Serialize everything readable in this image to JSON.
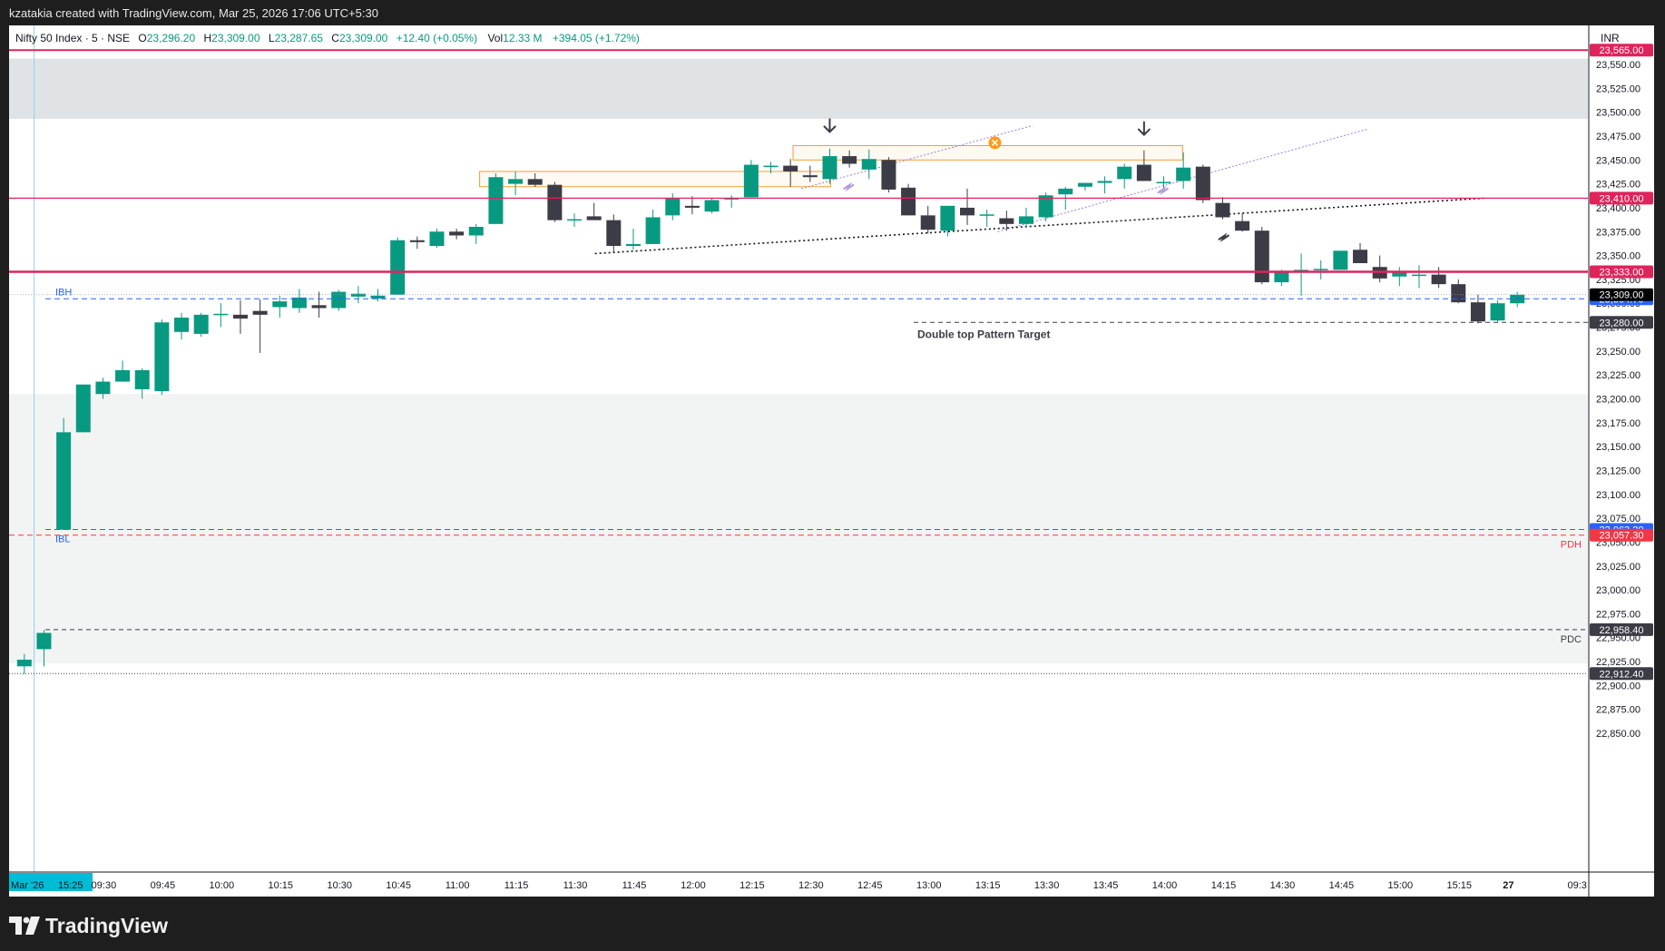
{
  "header": {
    "text": "kzatakia created with TradingView.com, Mar 25, 2026 17:06 UTC+5:30"
  },
  "legend": {
    "symbol": "Nifty 50 Index · 5 · NSE",
    "o_label": "O",
    "o_value": "23,296.20",
    "h_label": "H",
    "h_value": "23,309.00",
    "l_label": "L",
    "l_value": "23,287.65",
    "c_label": "C",
    "c_value": "23,309.00",
    "change": "+12.40 (+0.05%)",
    "vol_label": "Vol",
    "vol_value": "12.33 M",
    "vol_change": "+394.05 (+1.72%)"
  },
  "currency": "INR",
  "footer": {
    "brand": "TradingView"
  },
  "colors": {
    "up": "#089981",
    "down": "#3c3c46",
    "level_red": "#e0235a",
    "level_blue": "#2962ff",
    "pdh_red": "#f23645",
    "zone_gray": "#e0e3e6",
    "zone_light": "#f2f4f4",
    "box_orange": "#f0a030"
  },
  "chart_data": {
    "type": "candlestick",
    "title": "Nifty 50 Index · 5 · NSE",
    "ylim": [
      22830,
      23578
    ],
    "price_ticks": [
      "22,850.00",
      "22,875.00",
      "22,900.00",
      "22,925.00",
      "22,950.00",
      "22,975.00",
      "23,000.00",
      "23,025.00",
      "23,050.00",
      "23,075.00",
      "23,100.00",
      "23,125.00",
      "23,150.00",
      "23,175.00",
      "23,200.00",
      "23,225.00",
      "23,250.00",
      "23,275.00",
      "23,300.00",
      "23,325.00",
      "23,350.00",
      "23,375.00",
      "23,400.00",
      "23,425.00",
      "23,450.00",
      "23,475.00",
      "23,500.00",
      "23,525.00",
      "23,550.00"
    ],
    "time_ticks": [
      {
        "label": "Mar '26",
        "i": 0.5,
        "hl": true
      },
      {
        "label": "15:25",
        "i": 2.8,
        "hl": true
      },
      {
        "label": "09:30",
        "i": 4.5
      },
      {
        "label": "09:45",
        "i": 7.5
      },
      {
        "label": "10:00",
        "i": 10.5
      },
      {
        "label": "10:15",
        "i": 13.5
      },
      {
        "label": "10:30",
        "i": 16.5
      },
      {
        "label": "10:45",
        "i": 19.5
      },
      {
        "label": "11:00",
        "i": 22.5
      },
      {
        "label": "11:15",
        "i": 25.5
      },
      {
        "label": "11:30",
        "i": 28.5
      },
      {
        "label": "11:45",
        "i": 31.5
      },
      {
        "label": "12:00",
        "i": 34.5
      },
      {
        "label": "12:15",
        "i": 37.5
      },
      {
        "label": "12:30",
        "i": 40.5
      },
      {
        "label": "12:45",
        "i": 43.5
      },
      {
        "label": "13:00",
        "i": 46.5
      },
      {
        "label": "13:15",
        "i": 49.5
      },
      {
        "label": "13:30",
        "i": 52.5
      },
      {
        "label": "13:45",
        "i": 55.5
      },
      {
        "label": "14:00",
        "i": 58.5
      },
      {
        "label": "14:15",
        "i": 61.5
      },
      {
        "label": "14:30",
        "i": 64.5
      },
      {
        "label": "14:45",
        "i": 67.5
      },
      {
        "label": "15:00",
        "i": 70.5
      },
      {
        "label": "15:15",
        "i": 73.5
      },
      {
        "label": "27",
        "i": 76,
        "bold": true
      },
      {
        "label": "09:3",
        "i": 79.5
      }
    ],
    "candles": [
      [
        22920,
        22933,
        22912,
        22927
      ],
      [
        22938,
        22958,
        22920,
        22955
      ],
      [
        23063,
        23180,
        23063,
        23165
      ],
      [
        23165,
        23180,
        23165,
        23215
      ],
      [
        23205,
        23222,
        23200,
        23218
      ],
      [
        23218,
        23240,
        23218,
        23230
      ],
      [
        23210,
        23232,
        23200,
        23230
      ],
      [
        23208,
        23283,
        23204,
        23280
      ],
      [
        23270,
        23290,
        23262,
        23285
      ],
      [
        23268,
        23290,
        23265,
        23288
      ],
      [
        23288,
        23300,
        23275,
        23289
      ],
      [
        23288,
        23303,
        23268,
        23284
      ],
      [
        23292,
        23304,
        23248,
        23288
      ],
      [
        23296,
        23308,
        23285,
        23302
      ],
      [
        23295,
        23315,
        23290,
        23306
      ],
      [
        23298,
        23312,
        23285,
        23295
      ],
      [
        23295,
        23314,
        23292,
        23312
      ],
      [
        23307,
        23318,
        23300,
        23310
      ],
      [
        23305,
        23315,
        23302,
        23308
      ],
      [
        23309,
        23369,
        23309,
        23366
      ],
      [
        23366,
        23370,
        23357,
        23364
      ],
      [
        23360,
        23378,
        23358,
        23375
      ],
      [
        23375,
        23378,
        23367,
        23371
      ],
      [
        23371,
        23383,
        23362,
        23380
      ],
      [
        23383,
        23436,
        23383,
        23432
      ],
      [
        23425,
        23438,
        23413,
        23430
      ],
      [
        23430,
        23436,
        23422,
        23424
      ],
      [
        23424,
        23427,
        23385,
        23387
      ],
      [
        23388,
        23394,
        23380,
        23388
      ],
      [
        23391,
        23405,
        23388,
        23387
      ],
      [
        23387,
        23393,
        23354,
        23360
      ],
      [
        23360,
        23378,
        23356,
        23362
      ],
      [
        23362,
        23398,
        23362,
        23390
      ],
      [
        23392,
        23415,
        23387,
        23410
      ],
      [
        23402,
        23412,
        23393,
        23400
      ],
      [
        23396,
        23410,
        23394,
        23408
      ],
      [
        23410,
        23413,
        23400,
        23410
      ],
      [
        23411,
        23450,
        23411,
        23445
      ],
      [
        23443,
        23448,
        23436,
        23444
      ],
      [
        23444,
        23451,
        23422,
        23438
      ],
      [
        23434,
        23444,
        23427,
        23432
      ],
      [
        23430,
        23462,
        23425,
        23454
      ],
      [
        23454,
        23460,
        23442,
        23446
      ],
      [
        23440,
        23461,
        23430,
        23451
      ],
      [
        23450,
        23453,
        23416,
        23419
      ],
      [
        23421,
        23425,
        23392,
        23392
      ],
      [
        23392,
        23402,
        23373,
        23377
      ],
      [
        23376,
        23400,
        23370,
        23402
      ],
      [
        23400,
        23420,
        23382,
        23392
      ],
      [
        23393,
        23398,
        23380,
        23393
      ],
      [
        23389,
        23397,
        23376,
        23383
      ],
      [
        23383,
        23400,
        23380,
        23391
      ],
      [
        23390,
        23416,
        23386,
        23413
      ],
      [
        23414,
        23422,
        23398,
        23420
      ],
      [
        23422,
        23426,
        23418,
        23426
      ],
      [
        23426,
        23433,
        23415,
        23428
      ],
      [
        23430,
        23446,
        23420,
        23443
      ],
      [
        23445,
        23460,
        23428,
        23428
      ],
      [
        23426,
        23433,
        23419,
        23427
      ],
      [
        23428,
        23458,
        23420,
        23442
      ],
      [
        23443,
        23445,
        23405,
        23408
      ],
      [
        23405,
        23411,
        23388,
        23390
      ],
      [
        23386,
        23394,
        23375,
        23376
      ],
      [
        23376,
        23380,
        23320,
        23322
      ],
      [
        23322,
        23335,
        23318,
        23334
      ],
      [
        23335,
        23352,
        23308,
        23335
      ],
      [
        23335,
        23345,
        23325,
        23336
      ],
      [
        23335,
        23352,
        23340,
        23355
      ],
      [
        23356,
        23363,
        23345,
        23342
      ],
      [
        23338,
        23350,
        23322,
        23326
      ],
      [
        23328,
        23338,
        23318,
        23332
      ],
      [
        23330,
        23340,
        23316,
        23330
      ],
      [
        23330,
        23338,
        23316,
        23320
      ],
      [
        23320,
        23325,
        23300,
        23301
      ],
      [
        23301,
        23309,
        23279,
        23281
      ],
      [
        23282,
        23303,
        23280,
        23300
      ],
      [
        23300,
        23312,
        23296,
        23309
      ]
    ],
    "levels": [
      {
        "price": 23565.0,
        "label": "23,565.00",
        "color": "#e0235a",
        "width": 2,
        "dash": ""
      },
      {
        "price": 23410.0,
        "label": "23,410.00",
        "color": "#e0235a",
        "width": 1.2,
        "dash": ""
      },
      {
        "price": 23333.0,
        "label": "23,333.00",
        "color": "#e0235a",
        "width": 2.5,
        "dash": ""
      },
      {
        "price": 23304.7,
        "label": "23,304.70",
        "color": "#2962ff",
        "width": 1,
        "dash": "6,4"
      },
      {
        "price": 23280.0,
        "label": "23,280.00",
        "color": "#3c3c46",
        "width": 1,
        "dash": "5,4"
      },
      {
        "price": 23063.2,
        "label": "23,063.20",
        "color": "#2962ff",
        "width": 1,
        "dash": "6,4"
      },
      {
        "price": 23057.3,
        "label": "23,057.30",
        "color": "#f23645",
        "width": 1,
        "dash": "6,4"
      },
      {
        "price": 22958.4,
        "label": "22,958.40",
        "color": "#3c3c46",
        "width": 1,
        "dash": "5,4"
      },
      {
        "price": 22912.4,
        "label": "22,912.40",
        "color": "#3c3c46",
        "width": 1,
        "dash": "1,2"
      }
    ],
    "current_price": {
      "price": 23309.0,
      "label": "23,309.00"
    },
    "annotations": {
      "ibh": "IBH",
      "ibl": "IBL",
      "pdh": "PDH",
      "pdc": "PDC",
      "target": "Double top Pattern Target"
    },
    "grid": false
  }
}
